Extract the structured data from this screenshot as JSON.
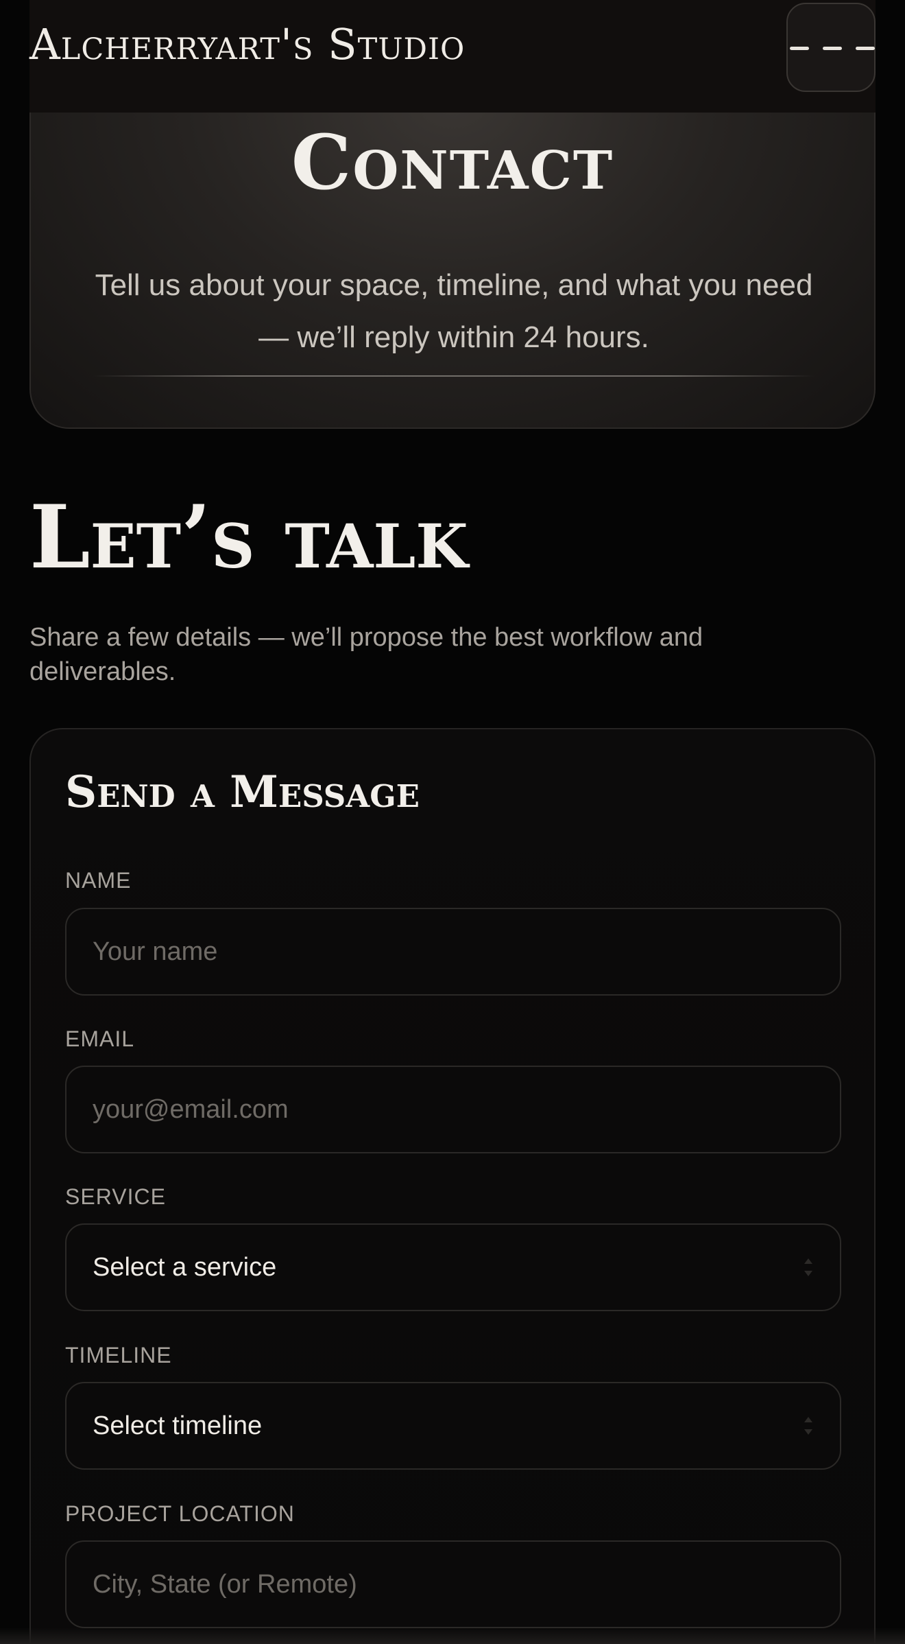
{
  "header": {
    "brand": "Alcherryart's Studio",
    "menu_icon": "hamburger-menu-icon"
  },
  "hero": {
    "title": "Contact",
    "subtitle": "Tell us about your space, timeline, and what you need — we’ll reply within 24 hours."
  },
  "section": {
    "title": "Let’s talk",
    "subtitle": "Share a few details — we’ll propose the best workflow and deliverables."
  },
  "form": {
    "title": "Send a Message",
    "name": {
      "label": "NAME",
      "placeholder": "Your name",
      "value": ""
    },
    "email": {
      "label": "EMAIL",
      "placeholder": "your@email.com",
      "value": ""
    },
    "service": {
      "label": "SERVICE",
      "selected": "Select a service"
    },
    "timeline": {
      "label": "TIMELINE",
      "selected": "Select timeline"
    },
    "location": {
      "label": "PROJECT LOCATION",
      "placeholder": "City, State (or Remote)",
      "value": ""
    }
  },
  "colors": {
    "background": "#050505",
    "text": "#f2efea",
    "muted": "#a8a39d",
    "card_border": "#262423"
  }
}
